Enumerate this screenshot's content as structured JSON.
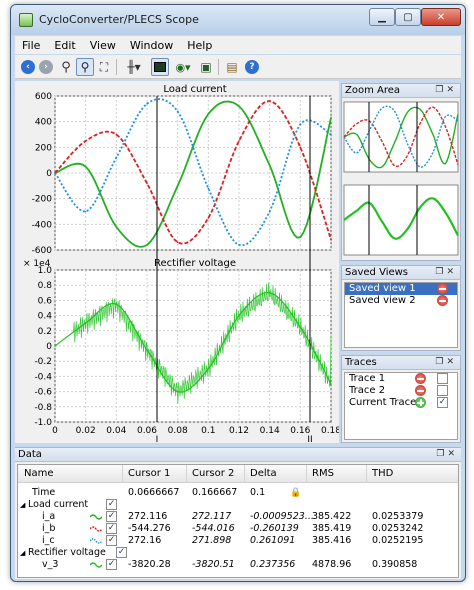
{
  "window": {
    "title": "CycloConverter/PLECS Scope"
  },
  "menu": [
    "File",
    "Edit",
    "View",
    "Window",
    "Help"
  ],
  "toolbar_icons": [
    "back-icon",
    "forward-icon",
    "zoom-icon",
    "zoom-box-icon",
    "zoom-fit-icon",
    "cursor-icon",
    "data-cursor-icon",
    "eye-icon",
    "export-icon",
    "settings-icon",
    "help-icon"
  ],
  "plot_top": {
    "title": "Load current",
    "y_ticks": [
      "600",
      "400",
      "200",
      "0",
      "-200",
      "-400",
      "-600"
    ]
  },
  "plot_bottom": {
    "title": "Rectifier voltage",
    "exponent": "× 1e4",
    "y_ticks": [
      "1.0",
      "0.8",
      "0.6",
      "0.4",
      "0.2",
      "0",
      "-0.2",
      "-0.4",
      "-0.6",
      "-0.8",
      "-1.0"
    ],
    "x_ticks": [
      "0",
      "0.02",
      "0.04",
      "0.06",
      "0.08",
      "0.1",
      "0.12",
      "0.14",
      "0.16",
      "0.18"
    ],
    "cursor_labels": [
      "I",
      "II"
    ]
  },
  "chart_data": [
    {
      "type": "line",
      "title": "Load current",
      "x": [
        0,
        0.02,
        0.04,
        0.06,
        0.08,
        0.1,
        0.12,
        0.14,
        0.16,
        0.18
      ],
      "ylim": [
        -600,
        600
      ],
      "xlim": [
        0,
        0.18
      ],
      "series": [
        {
          "name": "i_a",
          "color": "#22b022",
          "values": [
            0,
            50,
            -420,
            -560,
            -100,
            460,
            520,
            60,
            -500,
            430
          ]
        },
        {
          "name": "i_b",
          "color": "#dd2020",
          "values": [
            0,
            250,
            300,
            -80,
            -540,
            -350,
            250,
            560,
            200,
            -520
          ]
        },
        {
          "name": "i_c",
          "color": "#1e90e0",
          "values": [
            0,
            -300,
            120,
            540,
            480,
            -120,
            -560,
            -300,
            380,
            300
          ]
        }
      ]
    },
    {
      "type": "line",
      "title": "Rectifier voltage",
      "x": [
        0,
        0.02,
        0.04,
        0.06,
        0.08,
        0.1,
        0.12,
        0.14,
        0.16,
        0.18
      ],
      "ylim": [
        -1.0,
        1.0
      ],
      "xlim": [
        0,
        0.18
      ],
      "ylabel_exponent": "1e4",
      "series": [
        {
          "name": "v_3",
          "color": "#22c022",
          "values": [
            0,
            0.3,
            0.55,
            -0.05,
            -0.6,
            -0.3,
            0.4,
            0.7,
            0.25,
            -0.5
          ]
        }
      ]
    }
  ],
  "zoom_area": {
    "title": "Zoom Area"
  },
  "saved_views": {
    "title": "Saved Views",
    "items": [
      "Saved view 1",
      "Saved view 2"
    ],
    "selected": 0
  },
  "traces": {
    "title": "Traces",
    "items": [
      {
        "label": "Trace 1",
        "action": "remove",
        "checked": false
      },
      {
        "label": "Trace 2",
        "action": "remove",
        "checked": false
      },
      {
        "label": "Current Trace",
        "action": "add",
        "checked": true
      }
    ]
  },
  "data_panel": {
    "title": "Data",
    "columns": [
      "Name",
      "Cursor 1",
      "Cursor 2",
      "Delta",
      "RMS",
      "THD"
    ],
    "time_row": {
      "name": "Time",
      "c1": "0.0666667",
      "c2": "0.166667",
      "delta": "0.1"
    },
    "groups": [
      {
        "name": "Load current",
        "rows": [
          {
            "name": "i_a",
            "color": "#22b022",
            "c1": "272.116",
            "c2": "272.117",
            "delta": "-0.0009523...",
            "rms": "385.422",
            "thd": "0.0253379"
          },
          {
            "name": "i_b",
            "color": "#dd2020",
            "c1": "-544.276",
            "c2": "-544.016",
            "delta": "-0.260139",
            "rms": "385.419",
            "thd": "0.0253242"
          },
          {
            "name": "i_c",
            "color": "#1e90e0",
            "c1": "272.16",
            "c2": "271.898",
            "delta": "0.261091",
            "rms": "385.416",
            "thd": "0.0252195"
          }
        ]
      },
      {
        "name": "Rectifier voltage",
        "rows": [
          {
            "name": "v_3",
            "color": "#22c022",
            "c1": "-3820.28",
            "c2": "-3820.51",
            "delta": "0.237356",
            "rms": "4878.96",
            "thd": "0.390858"
          }
        ]
      }
    ]
  }
}
